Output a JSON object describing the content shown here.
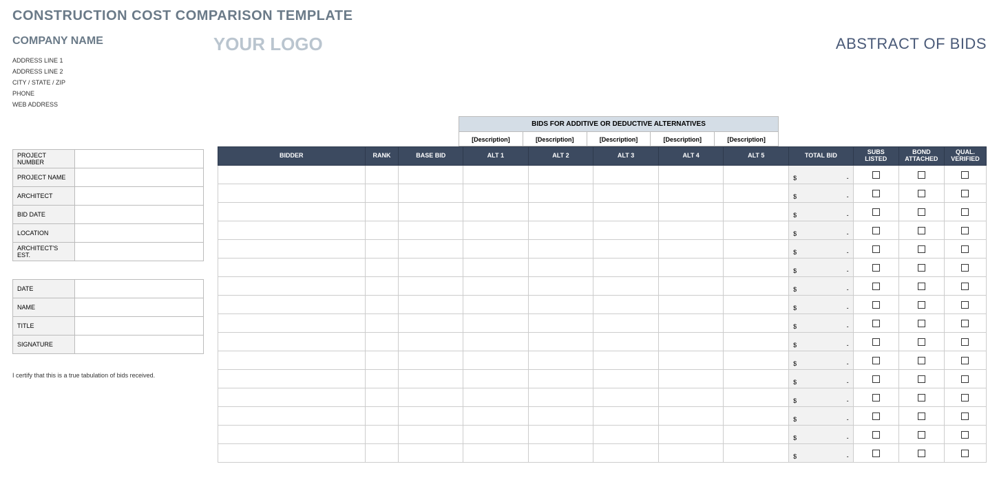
{
  "title": "CONSTRUCTION COST COMPARISON TEMPLATE",
  "company": {
    "name": "COMPANY NAME",
    "logo": "YOUR LOGO",
    "address1": "ADDRESS LINE 1",
    "address2": "ADDRESS LINE 2",
    "citystzip": "CITY / STATE / ZIP",
    "phone": "PHONE",
    "web": "WEB ADDRESS"
  },
  "right_heading": "ABSTRACT OF BIDS",
  "project_info_labels": {
    "project_number": "PROJECT NUMBER",
    "project_name": "PROJECT NAME",
    "architect": "ARCHITECT",
    "bid_date": "BID DATE",
    "location": "LOCATION",
    "arch_est": "ARCHITECT'S EST."
  },
  "signoff_labels": {
    "date": "DATE",
    "name": "NAME",
    "title": "TITLE",
    "signature": "SIGNATURE"
  },
  "certification": "I certify that this is a true tabulation of bids received.",
  "alt_section_title": "BIDS FOR ADDITIVE OR DEDUCTIVE ALTERNATIVES",
  "alt_descriptions": [
    "[Description]",
    "[Description]",
    "[Description]",
    "[Description]",
    "[Description]"
  ],
  "bids_headers": {
    "bidder": "BIDDER",
    "rank": "RANK",
    "base_bid": "BASE BID",
    "alt1": "ALT 1",
    "alt2": "ALT 2",
    "alt3": "ALT 3",
    "alt4": "ALT 4",
    "alt5": "ALT 5",
    "total_bid": "TOTAL BID",
    "subs_listed": "SUBS LISTED",
    "bond_attached": "BOND ATTACHED",
    "qual_verified": "QUAL. VERIFIED"
  },
  "currency_symbol": "$",
  "empty_amount": "-",
  "row_count": 16
}
